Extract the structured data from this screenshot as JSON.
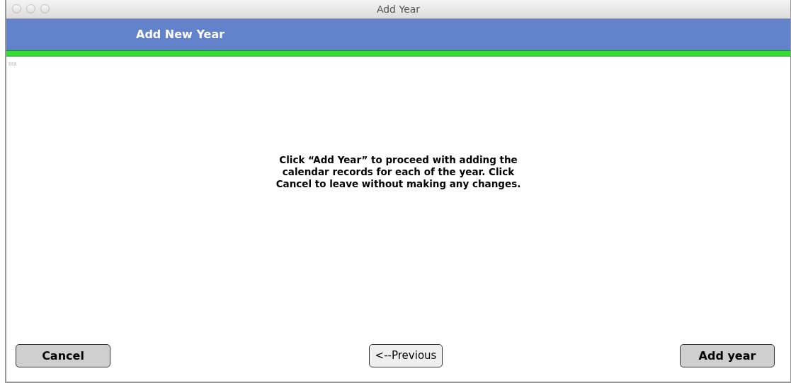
{
  "window": {
    "title": "Add Year"
  },
  "header": {
    "title": "Add New Year"
  },
  "message": "Click “Add Year” to proceed with adding the calendar records for each of the year.  Click Cancel to leave without making any changes.",
  "buttons": [
    {
      "label": "Cancel",
      "kind": "bold"
    },
    {
      "label": "<--Previous",
      "kind": "plain"
    },
    {
      "label": "Add year",
      "kind": "bold"
    }
  ]
}
